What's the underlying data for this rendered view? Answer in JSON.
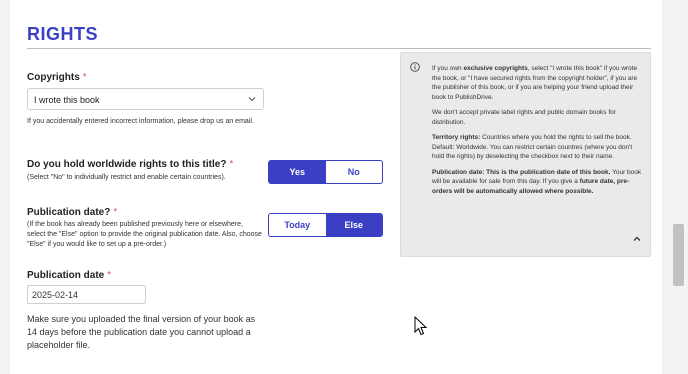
{
  "section": {
    "title": "RIGHTS"
  },
  "copyrights": {
    "label": "Copyrights",
    "required_mark": "*",
    "selected": "I wrote this book",
    "help": "If you accidentally entered incorrect information, please drop us an email."
  },
  "worldwide": {
    "label": "Do you hold worldwide rights to this title?",
    "required_mark": "*",
    "help": "(Select \"No\" to individually restrict and enable certain countries).",
    "options": [
      "Yes",
      "No"
    ],
    "selected": "Yes"
  },
  "pub_date_choice": {
    "label": "Publication date?",
    "required_mark": "*",
    "help": "(If the book has already been published previously here or elsewhere, select the \"Else\" option to provide the original publication date. Also, choose \"Else\" if you would like to set up a pre-order.)",
    "options": [
      "Today",
      "Else"
    ],
    "selected": "Else"
  },
  "pub_date": {
    "label": "Publication date",
    "required_mark": "*",
    "value": "2025-02-14",
    "note": "Make sure you uploaded the final version of your book as 14 days before the publication date you cannot upload a placeholder file."
  },
  "info_panel": {
    "p1_pre": "If you own ",
    "p1_bold": "exclusive copyrights",
    "p1_post": ", select \"I wrote this book\" if you wrote the book, or \"I have secured rights from the copyright holder\", if you are the publisher of this book, or if you are helping your friend upload their book to PublishDrive.",
    "p2": "We don't accept private label rights and public domain books for distribution.",
    "p3_bold": "Territory rights:",
    "p3_post": " Countries where you hold the rights to sell the book. Default: Worldwide. You can restrict certain countres (where you don't hold the rights) by deselecting the checkbox next to their name.",
    "p4_bold1": "Publication date: This is the publication date of this book.",
    "p4_mid": " Your book will be available for sale from this day. If you give a ",
    "p4_bold2": "future date, pre-orders will be automatically allowed where possible."
  },
  "colors": {
    "accent": "#3b3fc4",
    "required": "#e05252",
    "panel": "#eaeaea"
  },
  "icons": [
    "info-icon",
    "chevron-down-icon",
    "chevron-up-icon",
    "mouse-cursor-icon"
  ]
}
